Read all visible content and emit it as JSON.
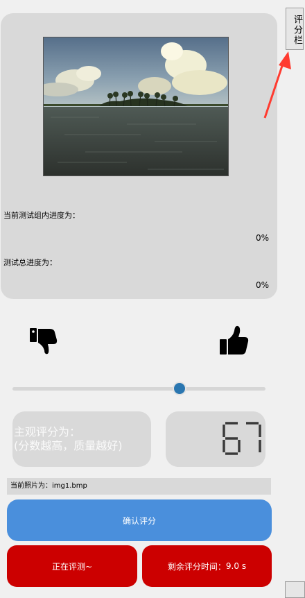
{
  "side_tab": {
    "label": "评分栏"
  },
  "progress": {
    "group_label": "当前测试组内进度为：",
    "group_value": "0%",
    "total_label": "测试总进度为：",
    "total_value": "0%"
  },
  "rating": {
    "slider_value": 67,
    "slider_max": 100,
    "score_label_line1": "主观评分为：",
    "score_label_line2": "(分数越高，质量越好)",
    "score_display": "67"
  },
  "current_photo": {
    "label": "当前照片为：",
    "filename": "img1.bmp"
  },
  "buttons": {
    "confirm": "确认评分",
    "status": "正在评测~",
    "remaining_label": "剩余评分时间：",
    "remaining_value": "9.0 s"
  },
  "colors": {
    "primary": "#4a8fdc",
    "danger": "#cc0000",
    "slider_knob": "#2a76b0",
    "arrow": "#ff3b30"
  },
  "icons": {
    "thumbs_down": "thumbs-down-icon",
    "thumbs_up": "thumbs-up-icon",
    "annotation_arrow": "red-arrow-icon"
  }
}
